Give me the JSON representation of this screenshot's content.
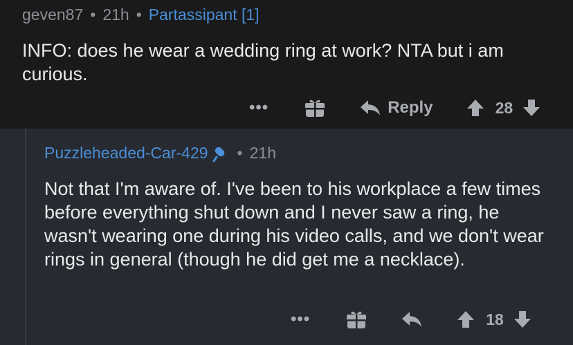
{
  "top_comment": {
    "username": "geven87",
    "time": "21h",
    "flair": "Partassipant [1]",
    "body": "INFO: does he wear a wedding ring at work? NTA but i am curious.",
    "actions": {
      "more": "•••",
      "reply_label": "Reply",
      "score": "28"
    }
  },
  "reply_comment": {
    "username": "Puzzleheaded-Car-429",
    "time": "21h",
    "body": "Not that I'm aware of. I've been to his workplace a few times before everything shut down and I never saw a ring, he wasn't wearing one during his video calls, and we don't wear rings in general (though he did get me a necklace).",
    "actions": {
      "more": "•••",
      "score": "18"
    }
  },
  "separator": "•",
  "colors": {
    "background": "#1a1a1b",
    "reply_background": "#272a30",
    "link_blue": "#4a8fd8",
    "meta_gray": "#8b8e94",
    "text": "#e8e9ea"
  }
}
